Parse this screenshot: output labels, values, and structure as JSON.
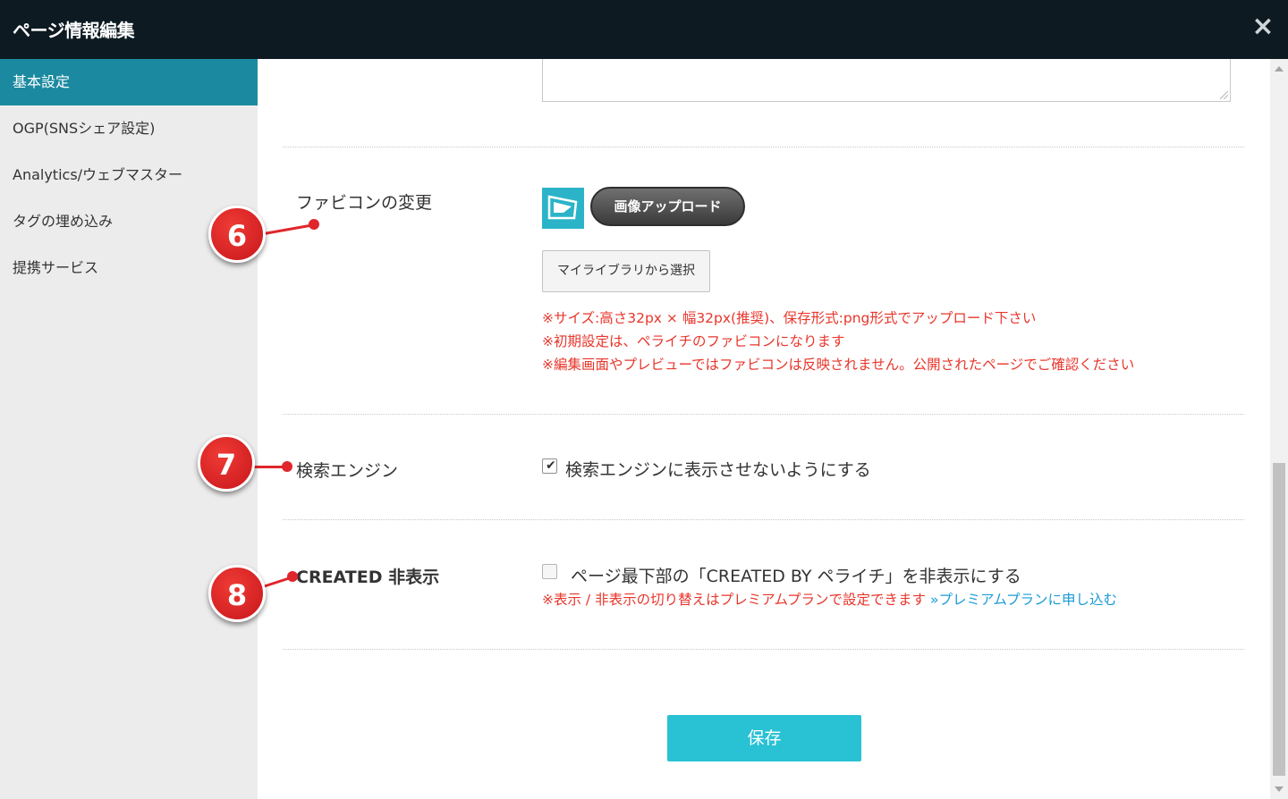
{
  "window": {
    "title": "ページ情報編集",
    "close_label": "×"
  },
  "sidebar": {
    "items": [
      {
        "label": "基本設定",
        "active": true
      },
      {
        "label": "OGP(SNSシェア設定)",
        "active": false
      },
      {
        "label": "Analytics/ウェブマスター",
        "active": false
      },
      {
        "label": "タグの埋め込み",
        "active": false
      },
      {
        "label": "提携サービス",
        "active": false
      }
    ]
  },
  "favicon": {
    "label": "ファビコンの変更",
    "upload_label": "画像アップロード",
    "library_label": "マイライブラリから選択",
    "notes": [
      "※サイズ:高さ32px × 幅32px(推奨)、保存形式:png形式でアップロード下さい",
      "※初期設定は、ペライチのファビコンになります",
      "※編集画面やプレビューではファビコンは反映されません。公開されたページでご確認ください"
    ]
  },
  "search_engine": {
    "label": "検索エンジン",
    "checkbox_label": "検索エンジンに表示させないようにする",
    "checked": true
  },
  "created": {
    "label": "CREATED 非表示",
    "checkbox_label": "ページ最下部の「CREATED BY ペライチ」を非表示にする",
    "checked": false,
    "note": "※表示 / 非表示の切り替えはプレミアムプランで設定できます",
    "link": "»プレミアムプランに申し込む"
  },
  "save_label": "保存",
  "badges": [
    "6",
    "7",
    "8"
  ],
  "colors": {
    "titlebar": "#0d1a21",
    "active_tab": "#1b8aa0",
    "save_button": "#29c1d4",
    "note_red": "#e8362b",
    "link_blue": "#1a9bd5",
    "badge_red": "#d9201f"
  }
}
